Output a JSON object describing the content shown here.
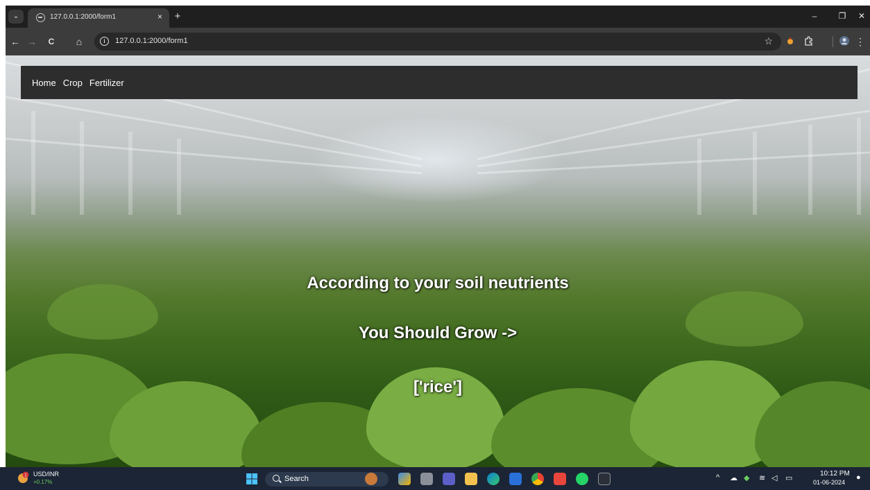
{
  "browser": {
    "tab_title": "127.0.0.1:2000/form1",
    "tab_close": "×",
    "new_tab": "+",
    "url": "127.0.0.1:2000/form1",
    "window_controls": {
      "minimize": "–",
      "restore": "❐",
      "close": "✕"
    },
    "nav": {
      "back": "←",
      "forward": "→",
      "reload": "C",
      "home": "⌂"
    },
    "bookmark_star": "☆",
    "menu": "⋮"
  },
  "page": {
    "nav_links": [
      "Home",
      "Crop",
      "Fertilizer"
    ],
    "result_line1": "According to your soil neutrients",
    "result_line2": "You Should Grow ->",
    "result_value": "['rice']"
  },
  "taskbar": {
    "ticker_label": "USD/INR",
    "ticker_change": "+0.17%",
    "ticker_badge": "1",
    "search_placeholder": "Search",
    "clock_time": "10:12 PM",
    "clock_date": "01-06-2024",
    "tray_chevron": "^",
    "pinned_apps": [
      "photos-app",
      "file-explorer",
      "teams",
      "folder",
      "edge",
      "store",
      "chrome",
      "office",
      "whatsapp",
      "terminal"
    ]
  },
  "colors": {
    "chrome_dark": "#1f1f1f",
    "toolbar": "#3c3c3c",
    "navbar": "#2d2d2d",
    "taskbar": "#1b2535",
    "text_white": "#ffffff"
  }
}
